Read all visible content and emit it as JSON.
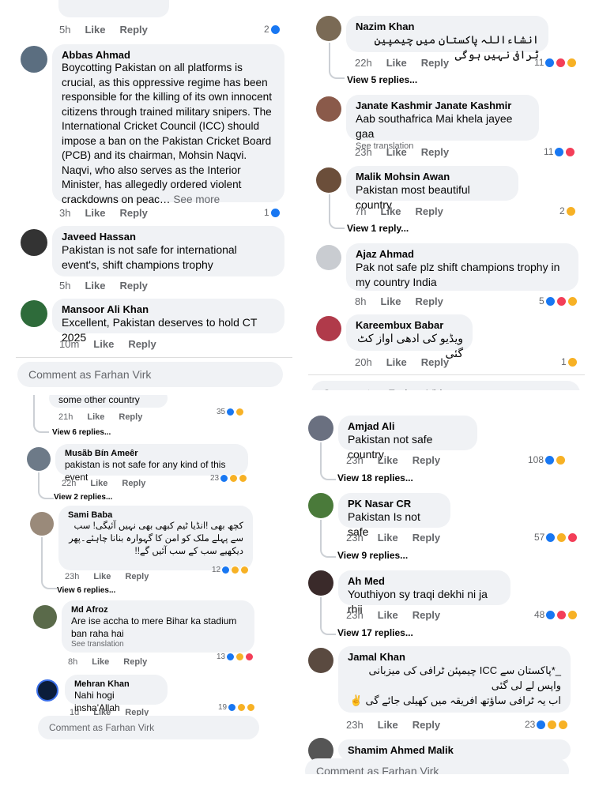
{
  "account": "Comment as Farhan Virk",
  "like": "Like",
  "reply": "Reply",
  "see_translation": "See translation",
  "p1": {
    "top": {
      "time": "5h",
      "count": "2"
    },
    "c1": {
      "name": "Abbas Ahmad",
      "text": "Boycotting Pakistan on all platforms is crucial, as this oppressive regime has been responsible for the killing of its own innocent citizens through trained military snipers. The International Cricket Council (ICC) should impose a ban on the Pakistan Cricket Board (PCB) and its chairman, Mohsin Naqvi. Naqvi, who also serves as the Interior Minister, has allegedly ordered violent crackdowns on peac…",
      "see_more": "See more",
      "time": "3h",
      "count": "1"
    },
    "c2": {
      "name": "Javeed Hassan",
      "text": "Pakistan is not safe for international event's, shift champions trophy",
      "time": "5h"
    },
    "c3": {
      "name": "Mansoor Ali Khan",
      "text": "Excellent, Pakistan deserves to hold CT 2025",
      "time": "10m"
    }
  },
  "p2": {
    "c1": {
      "name": "Nazim Khan",
      "text": "انشاءاللہ پاکستان میں چیمپین ٹرافی نہیں ہوگی",
      "time": "22h",
      "count": "11",
      "replies": "View 5 replies..."
    },
    "c2": {
      "name": "Janate Kashmir Janate Kashmir",
      "text": "Aab southafrica Mai khela jayee gaa",
      "time": "23h",
      "count": "11"
    },
    "c3": {
      "name": "Malik Mohsin Awan",
      "text": "Pakistan most beautiful country",
      "time": "7h",
      "count": "2",
      "replies": "View 1 reply..."
    },
    "c4": {
      "name": "Ajaz Ahmad",
      "text": "Pak not safe plz shift champions trophy in my country India",
      "time": "8h",
      "count": "5"
    },
    "c5": {
      "name": "Kareembux Babar",
      "text": "ویڈیو کی ادھی اواز کٹ گئی",
      "time": "20h",
      "count": "1"
    }
  },
  "p3": {
    "top": {
      "text": "some other country",
      "time": "21h",
      "count": "35",
      "replies": "View 6 replies..."
    },
    "c1": {
      "name": "Musãb Bín Ameêr",
      "text": "pakistan is not safe for any kind of this event",
      "time": "22h",
      "count": "23",
      "replies": "View 2 replies..."
    },
    "c2": {
      "name": "Sami Baba",
      "text": "کچھ بھی !انڈیا ٹیم کبھی بھی نہیں آئیگی! سب سے پہلے ملک کو امن کا گہوارہ بنانا چاہئے۔پھر دیکھیے سب کے سب آئیں گے!!",
      "time": "23h",
      "count": "12",
      "replies": "View 6 replies..."
    },
    "c3": {
      "name": "Md Afroz",
      "text": "Are ise accha to mere Bihar ka stadium ban raha hai",
      "time": "8h",
      "count": "13"
    },
    "c4": {
      "name": "Mehran Khan",
      "text": "Nahi hogi insha'Allah",
      "time": "1d",
      "count": "19"
    }
  },
  "p4": {
    "c1": {
      "name": "Amjad Ali",
      "text": "Pakistan not safe country",
      "time": "23h",
      "count": "108",
      "replies": "View 18 replies..."
    },
    "c2": {
      "name": "PK Nasar CR",
      "text": "Pakistan Is not safe",
      "time": "23h",
      "count": "57",
      "replies": "View 9 replies..."
    },
    "c3": {
      "name": "Ah Med",
      "text": "Youthiyon sy traqi dekhi ni ja rhii",
      "time": "23h",
      "count": "48",
      "replies": "View 17 replies..."
    },
    "c4": {
      "name": "Jamal Khan",
      "text1": "_*پاکستان سے ICC چیمپئن ٹرافی کی میزبانی واپس لے لی گئی",
      "text2": "اب یہ ٹرافی ساؤتھ افریقہ میں کھیلی جائے گی ✌️",
      "time": "23h",
      "count": "23"
    },
    "c5": {
      "name": "Shamim Ahmed Malik"
    }
  },
  "colors": {
    "like": "#1877f2",
    "love": "#f33e58",
    "haha": "#f7b125",
    "bubble": "#f0f2f5"
  }
}
